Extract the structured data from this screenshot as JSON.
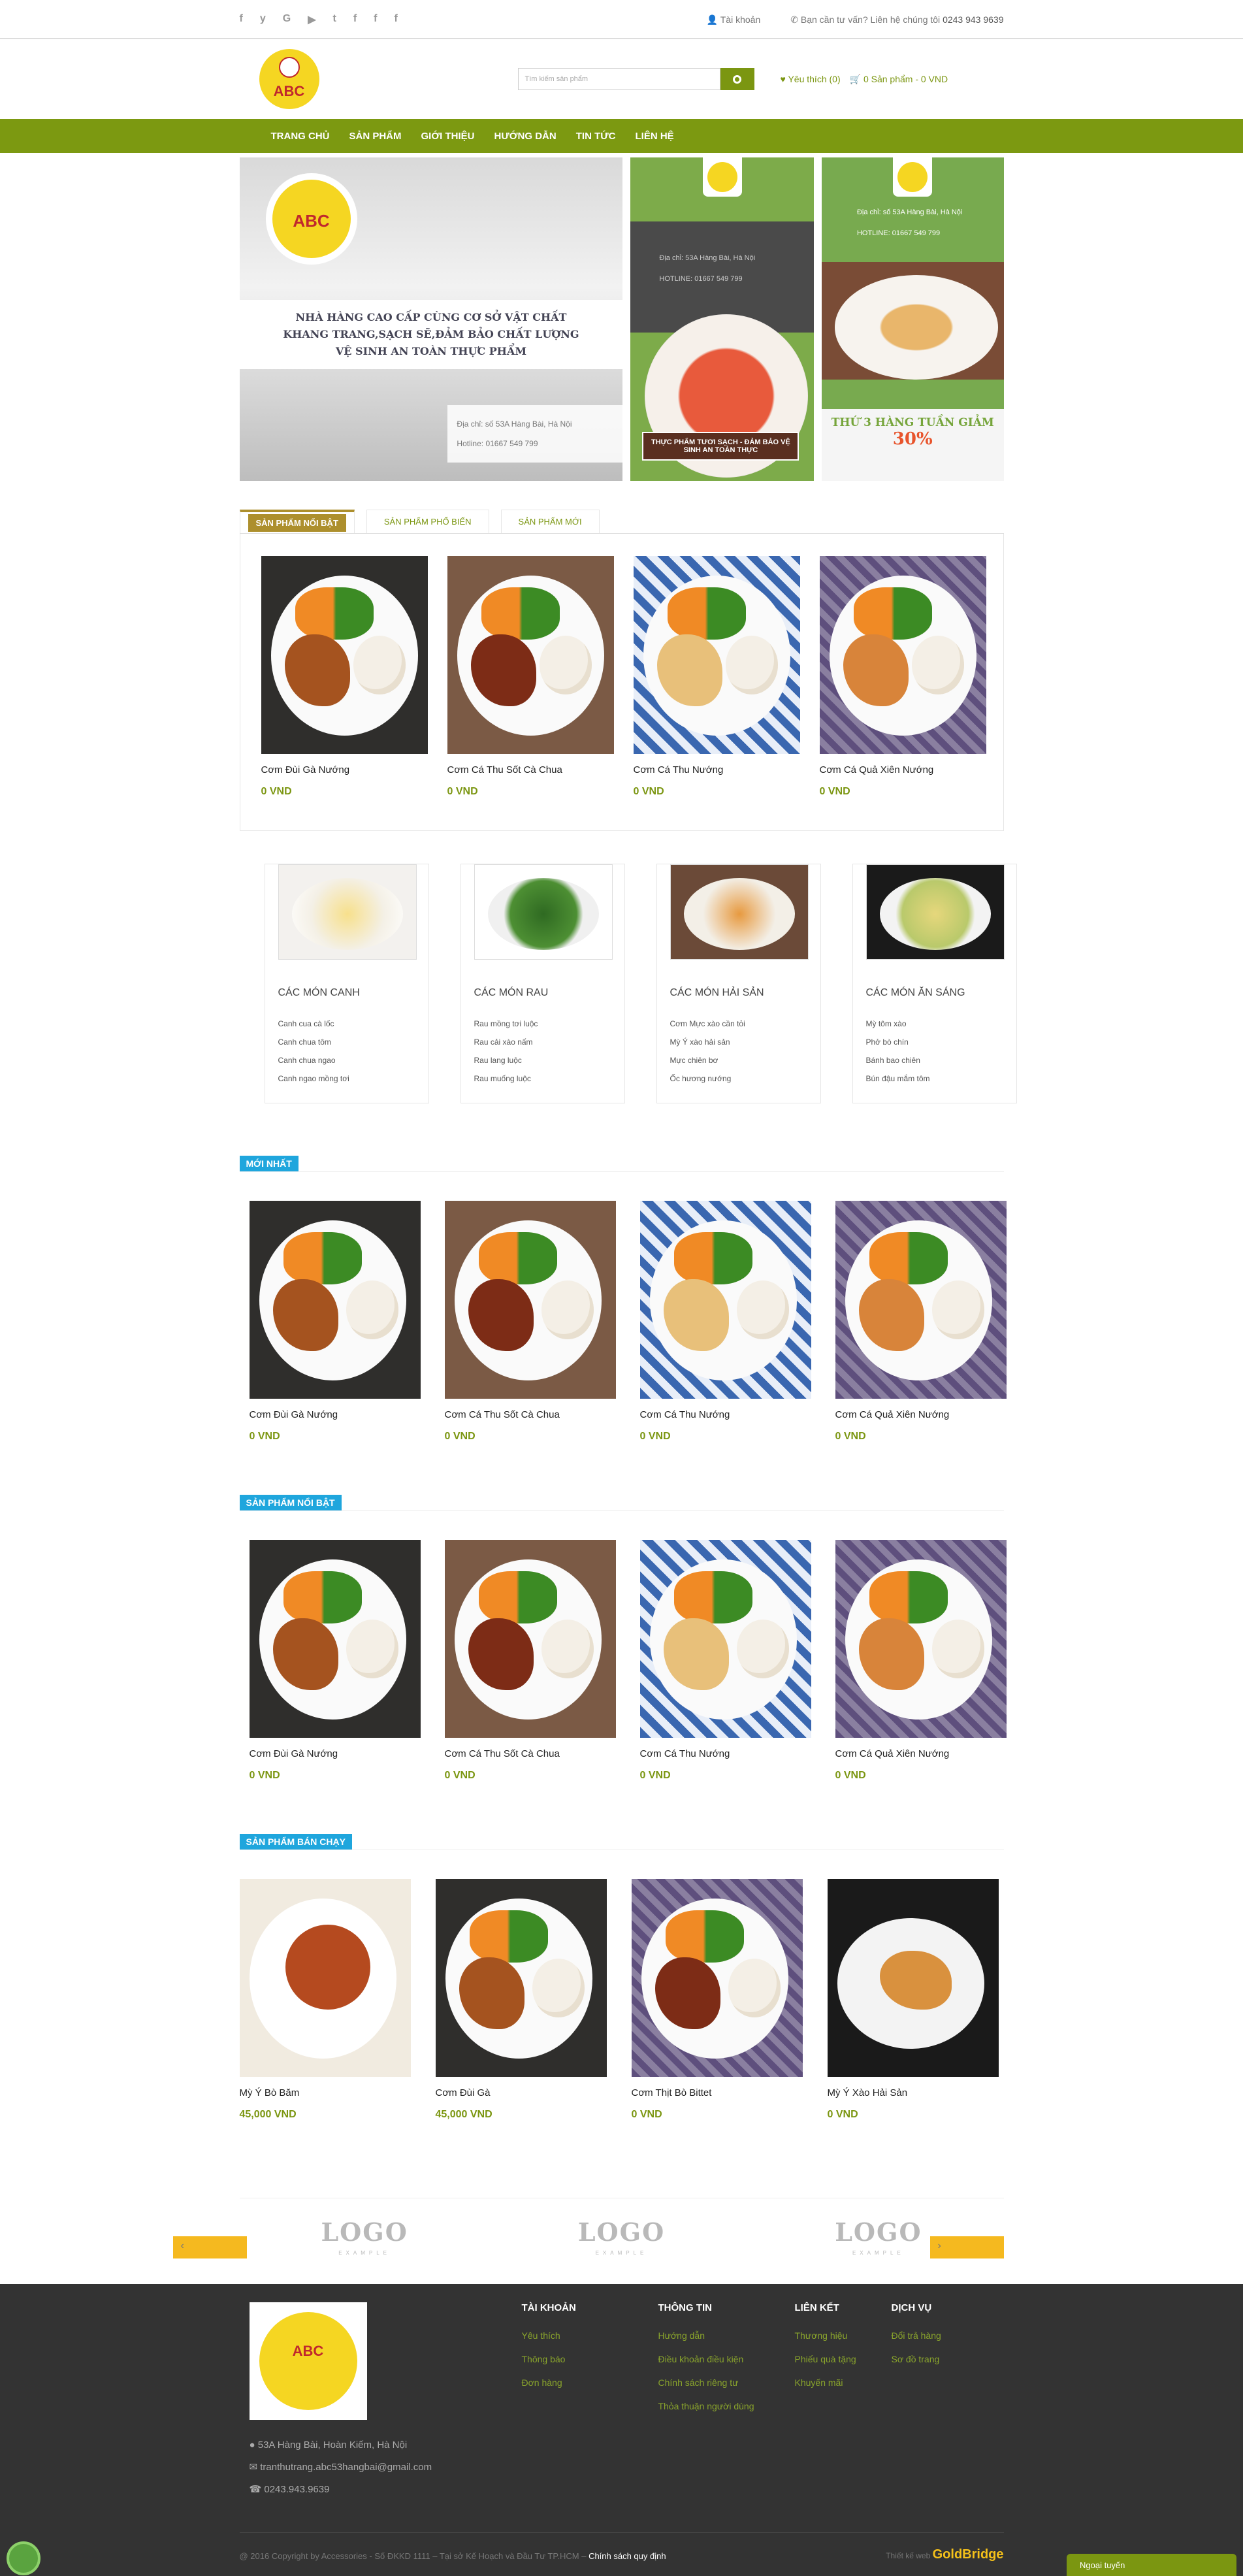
{
  "topbar": {
    "social_icons": [
      "f",
      "y",
      "G",
      "▶",
      "t",
      "f",
      "f",
      "f"
    ],
    "account": "Tài khoản",
    "support": "Bạn cần tư vấn? Liên hệ chúng tôi",
    "phone": "0243 943 9639"
  },
  "header": {
    "logo_text": "ABC",
    "search_placeholder": "Tìm kiếm sản phẩm",
    "wishlist": "Yêu thích (0)",
    "cart": "0 Sản phẩm - 0 VND"
  },
  "nav": [
    "TRANG CHỦ",
    "SẢN PHẨM",
    "GIỚI THIỆU",
    "HƯỚNG DẪN",
    "TIN TỨC",
    "LIÊN HỆ"
  ],
  "banner": {
    "logo_text": "ABC",
    "headline": [
      "NHÀ HÀNG CAO CẤP CÙNG CƠ SỞ VẬT CHẤT",
      "KHANG TRANG,SẠCH SẼ,ĐẢM BẢO CHẤT LƯỢNG",
      "VỆ SINH AN TOÀN THỰC PHẨM"
    ],
    "address_lines": [
      "Địa chỉ: số 53A Hàng Bài, Hà Nội",
      "Hotline: 01667 549 799"
    ],
    "b2_lines": [
      "Địa chỉ: 53A Hàng Bài, Hà Nội",
      "HOTLINE: 01667 549 799"
    ],
    "b2_tag": "THỰC PHẨM TƯƠI SẠCH - ĐẢM BẢO VỆ SINH AN TOÀN THỰC",
    "b3_lines": [
      "Địa chỉ: số 53A Hàng Bài, Hà Nội",
      "HOTLINE: 01667 549 799"
    ],
    "b3_promo": "THỨ 3 HÀNG TUẦN GIẢM",
    "b3_percent": "30%"
  },
  "tabs": [
    "SẢN PHẨM NỔI BẬT",
    "SẢN PHẨM PHỔ BIẾN",
    "SẢN PHẨM MỚI"
  ],
  "tab_products": [
    {
      "name": "Cơm Đùi Gà Nướng",
      "price": "0 VND"
    },
    {
      "name": "Cơm Cá Thu Sốt Cà Chua",
      "price": "0 VND"
    },
    {
      "name": "Cơm Cá Thu Nướng",
      "price": "0 VND"
    },
    {
      "name": "Cơm Cá Quả Xiên Nướng",
      "price": "0 VND"
    }
  ],
  "categories": [
    {
      "title": "CÁC MÓN CANH",
      "items": [
        "Canh cua cà lốc",
        "Canh chua tôm",
        "Canh chua ngao",
        "Canh ngao mồng tơi"
      ]
    },
    {
      "title": "CÁC MÓN RAU",
      "items": [
        "Rau mồng tơi luộc",
        "Rau cải xào nấm",
        "Rau lang luộc",
        "Rau muống luộc"
      ]
    },
    {
      "title": "CÁC MÓN HẢI SẢN",
      "items": [
        "Cơm Mực xào cần tỏi",
        "Mỳ Ý xào hải sản",
        "Mực chiên bơ",
        "Ốc hương nướng"
      ]
    },
    {
      "title": "CÁC MÓN ĂN SÁNG",
      "items": [
        "Mỳ tôm xào",
        "Phở bò chín",
        "Bánh bao chiên",
        "Bún đậu mắm tôm"
      ]
    }
  ],
  "section_new": {
    "title": "MỚI NHẤT",
    "products": [
      {
        "name": "Cơm Đùi Gà Nướng",
        "price": "0 VND"
      },
      {
        "name": "Cơm Cá Thu Sốt Cà Chua",
        "price": "0 VND"
      },
      {
        "name": "Cơm Cá Thu Nướng",
        "price": "0 VND"
      },
      {
        "name": "Cơm Cá Quả Xiên Nướng",
        "price": "0 VND"
      }
    ]
  },
  "section_featured": {
    "title": "SẢN PHẨM NỔI BẬT",
    "products": [
      {
        "name": "Cơm Đùi Gà Nướng",
        "price": "0 VND"
      },
      {
        "name": "Cơm Cá Thu Sốt Cà Chua",
        "price": "0 VND"
      },
      {
        "name": "Cơm Cá Thu Nướng",
        "price": "0 VND"
      },
      {
        "name": "Cơm Cá Quả Xiên Nướng",
        "price": "0 VND"
      }
    ]
  },
  "section_best": {
    "title": "SẢN PHẨM BÁN CHẠY",
    "products": [
      {
        "name": "Mỳ Ý Bò Băm",
        "price": "45,000 VND"
      },
      {
        "name": "Cơm Đùi Gà",
        "price": "45,000 VND"
      },
      {
        "name": "Cơm Thịt Bò Bittet",
        "price": "0 VND"
      },
      {
        "name": "Mỳ Ý Xào Hải Sản",
        "price": "0 VND"
      }
    ]
  },
  "partner_logos": [
    {
      "main": "LOGO",
      "sub": "EXAMPLE"
    },
    {
      "main": "LOGO",
      "sub": "EXAMPLE"
    },
    {
      "main": "LOGO",
      "sub": "EXAMPLE"
    }
  ],
  "footer": {
    "logo_text": "ABC",
    "address": "53A Hàng Bài, Hoàn Kiếm, Hà Nội",
    "email": "tranthutrang.abc53hangbai@gmail.com",
    "phone": "0243.943.9639",
    "columns": [
      {
        "title": "TÀI KHOẢN",
        "links": [
          "Yêu thích",
          "Thông báo",
          "Đơn hàng"
        ]
      },
      {
        "title": "THÔNG TIN",
        "links": [
          "Hướng dẫn",
          "Điều khoản điều kiện",
          "Chính sách riêng tư",
          "Thỏa thuận người dùng"
        ]
      },
      {
        "title": "LIÊN KẾT",
        "links": [
          "Thương hiệu",
          "Phiếu quà tặng",
          "Khuyến mãi"
        ]
      },
      {
        "title": "DỊCH VỤ",
        "links": [
          "Đổi trả hàng",
          "Sơ đồ trang"
        ]
      }
    ],
    "copyright": "@ 2016 Copyright by Accessories - Số ĐKKD 1111 – Tại sở Kế Hoạch và Đầu Tư TP.HCM –",
    "policy": "Chính sách quy định",
    "designed_by": "Thiết kế web",
    "brand": "GoldBridge"
  },
  "chat_label": "Ngoại tuyến",
  "colors": {
    "brand_green": "#7c9911",
    "section_blue": "#1fa6dd",
    "tab_gold": "#ad8f2d",
    "arrow_yellow": "#f5b91f"
  }
}
